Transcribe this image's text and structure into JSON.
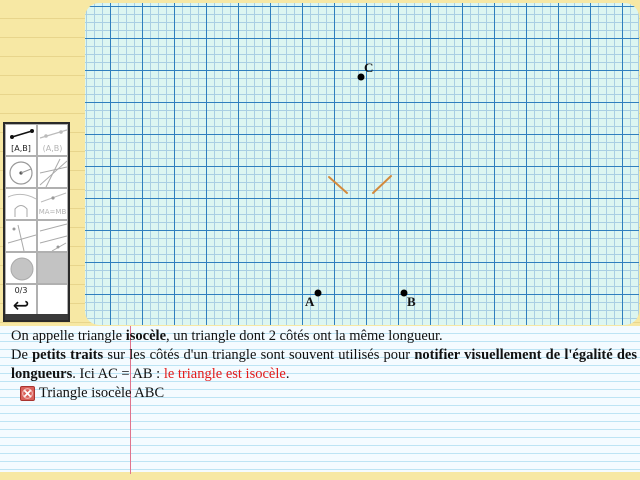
{
  "figure": {
    "points": [
      {
        "name": "A",
        "label": "A"
      },
      {
        "name": "B",
        "label": "B"
      },
      {
        "name": "C",
        "label": "C"
      }
    ],
    "tick_color": "#d38a3c",
    "grid_major_color": "#2f7fbe",
    "grid_minor_color": "#a9cfe3",
    "background_color": "#dcf6f1"
  },
  "toolbox": {
    "segment_label": "[A,B]",
    "segment_gray_label": "(A,B)",
    "midpoint_label": "MA=MB",
    "undo_counter": "0/3",
    "undo_icon": "↩"
  },
  "text": {
    "line1_a": "On appelle triangle ",
    "line1_b": "isocèle",
    "line1_c": ", un triangle dont 2 côtés ont la même longueur.",
    "line2_a": "De ",
    "line2_b": "petits traits",
    "line2_c": " sur les côtés d'un triangle sont souvent utilisés pour ",
    "line2_d": "notifier visuellement de l'égalité des longueurs",
    "line2_e": ". Ici AC = AB : ",
    "line2_f": "le triangle est isocèle",
    "line2_g": ".",
    "title": "Triangle isocèle ABC",
    "accent_red": "#e21b1b"
  }
}
